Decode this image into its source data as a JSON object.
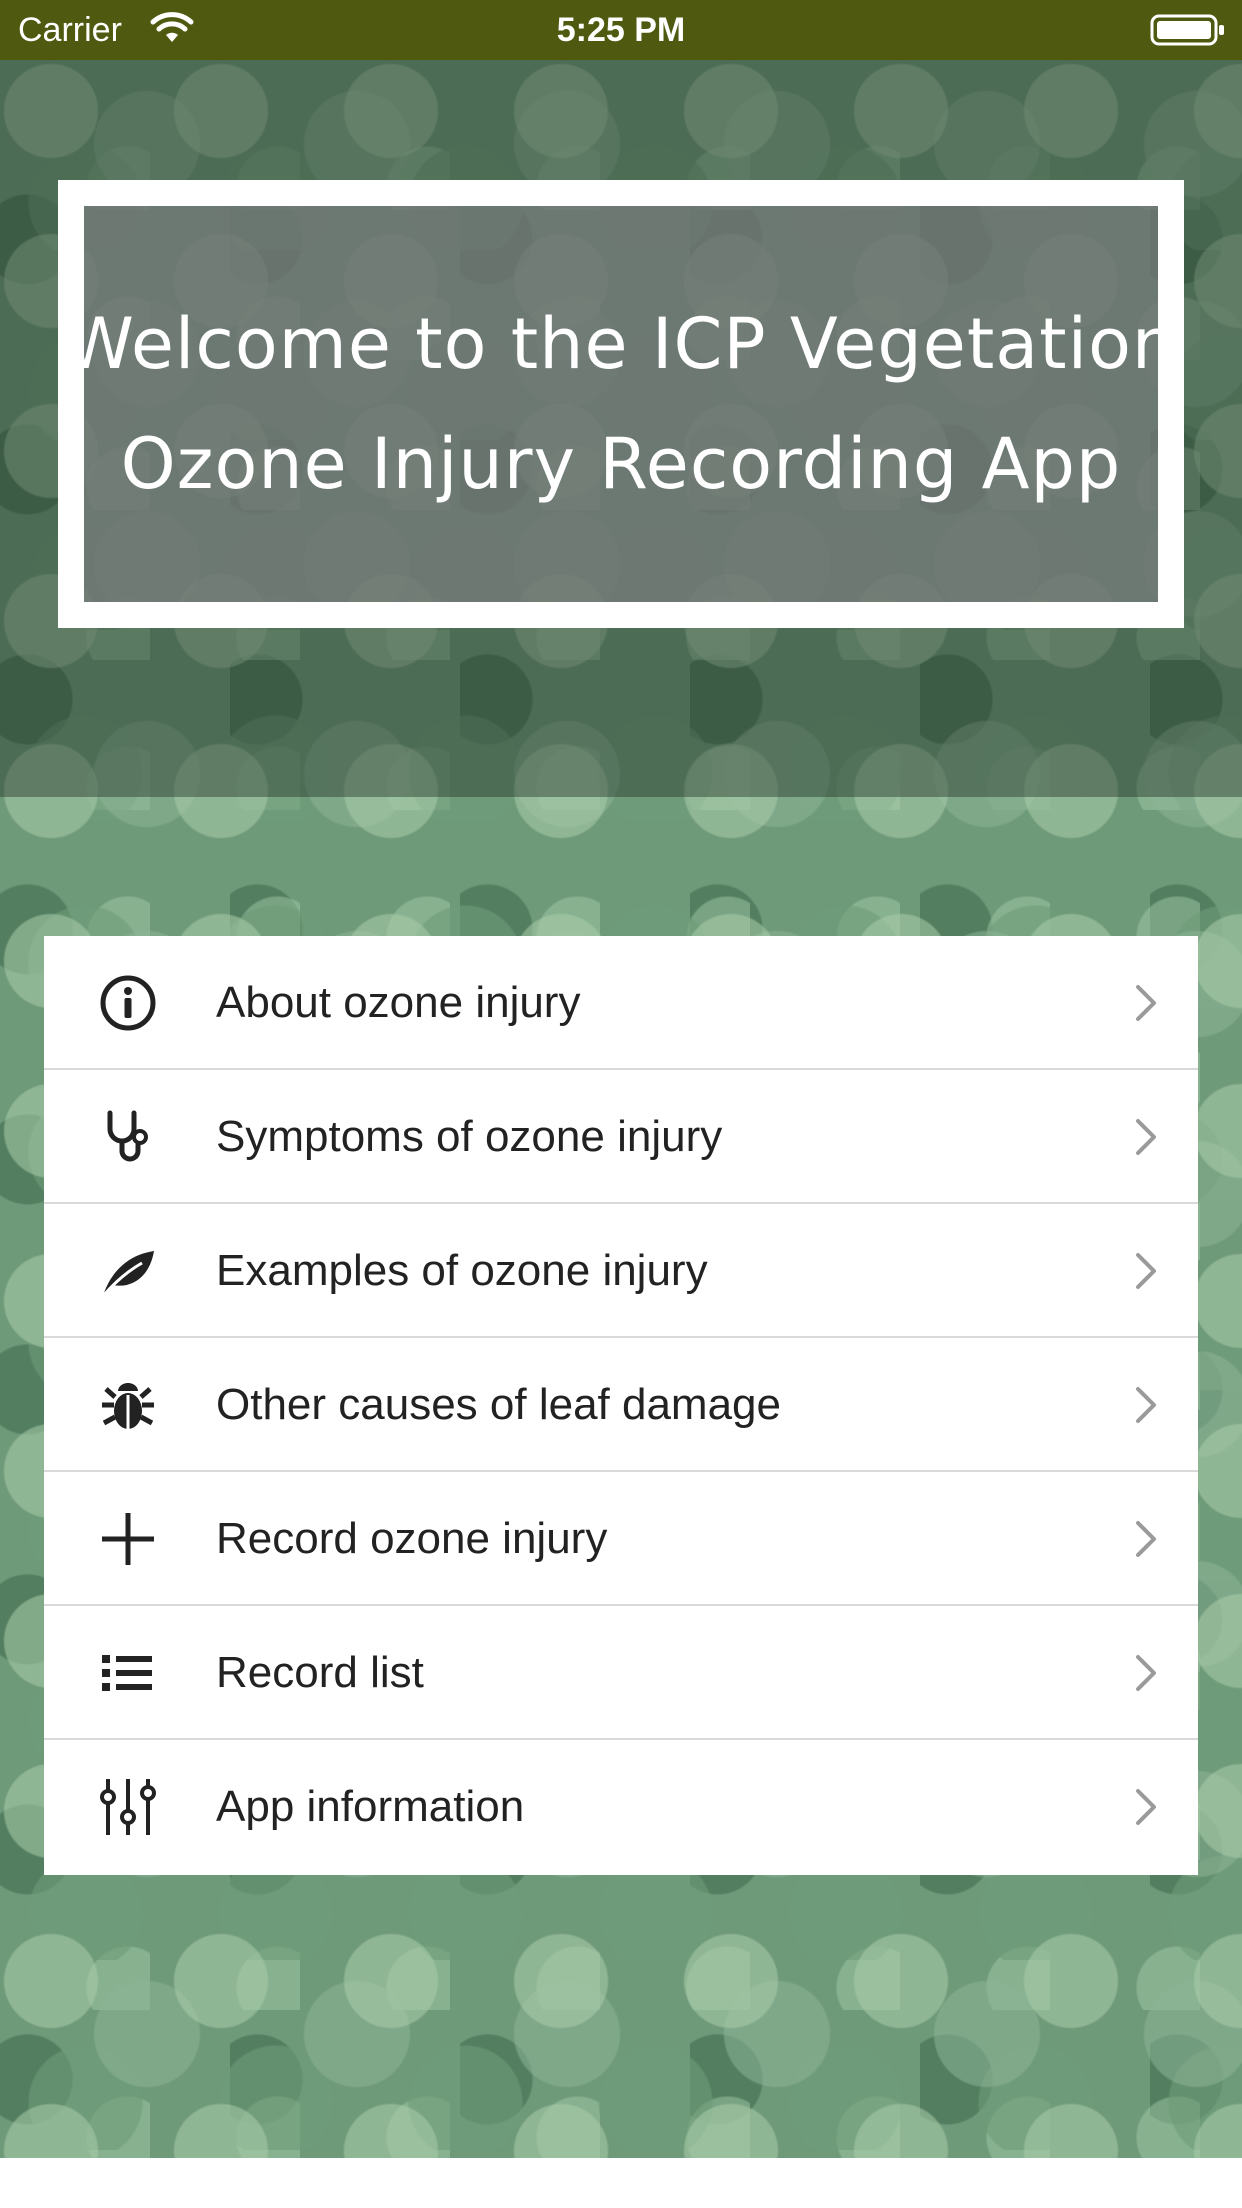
{
  "status_bar": {
    "carrier": "Carrier",
    "time": "5:25 PM",
    "wifi_icon": "wifi-icon",
    "battery_icon": "battery-icon"
  },
  "welcome": {
    "line1": "Welcome to the ICP Vegetation",
    "line2": "Ozone Injury Recording App"
  },
  "menu": {
    "items": [
      {
        "label": "About ozone injury",
        "icon": "info-icon"
      },
      {
        "label": "Symptoms of ozone injury",
        "icon": "stethoscope-icon"
      },
      {
        "label": "Examples of ozone injury",
        "icon": "leaf-icon"
      },
      {
        "label": "Other causes of leaf damage",
        "icon": "bug-icon"
      },
      {
        "label": "Record ozone injury",
        "icon": "plus-icon"
      },
      {
        "label": "Record list",
        "icon": "list-icon"
      },
      {
        "label": "App information",
        "icon": "sliders-icon"
      }
    ]
  },
  "colors": {
    "status_bar": "#4f5a10",
    "menu_bg": "#ffffff",
    "text": "#222222",
    "chevron": "#9a9a9a"
  }
}
